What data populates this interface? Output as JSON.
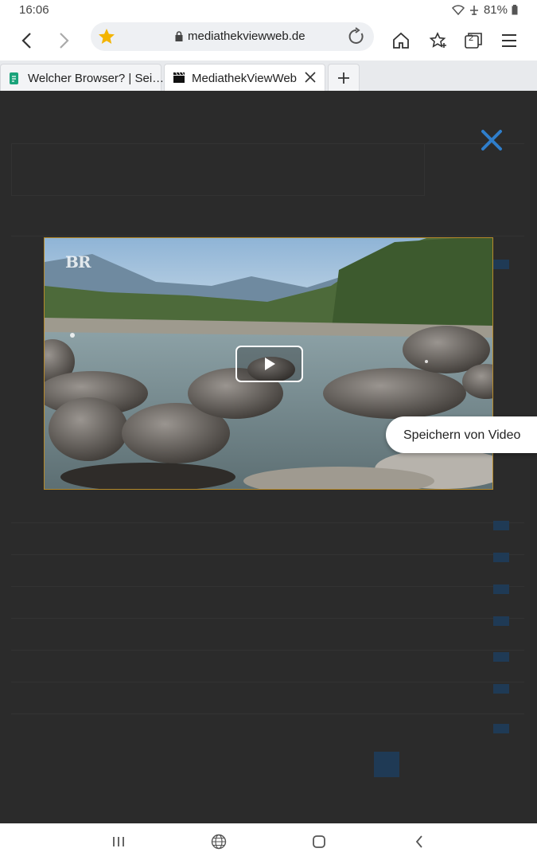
{
  "status_bar": {
    "time": "16:06",
    "battery": "81%"
  },
  "browser": {
    "url": "mediathekviewweb.de",
    "tabs": [
      {
        "label": "Welcher Browser? | Sei…",
        "active": false
      },
      {
        "label": "MediathekViewWeb",
        "active": true
      }
    ],
    "tab_count": "2"
  },
  "player": {
    "channel_logo": "BR",
    "popup_label": "Speichern von Video"
  },
  "colors": {
    "close_accent": "#2f7ecb",
    "star": "#f3b400"
  },
  "icons": [
    "back-icon",
    "forward-icon",
    "star-icon",
    "lock-icon",
    "reload-icon",
    "home-icon",
    "bookmarks-icon",
    "tabs-icon",
    "menu-icon",
    "close-icon",
    "play-icon",
    "recent-apps-icon",
    "internet-icon",
    "home-button-icon",
    "nav-back-icon"
  ]
}
